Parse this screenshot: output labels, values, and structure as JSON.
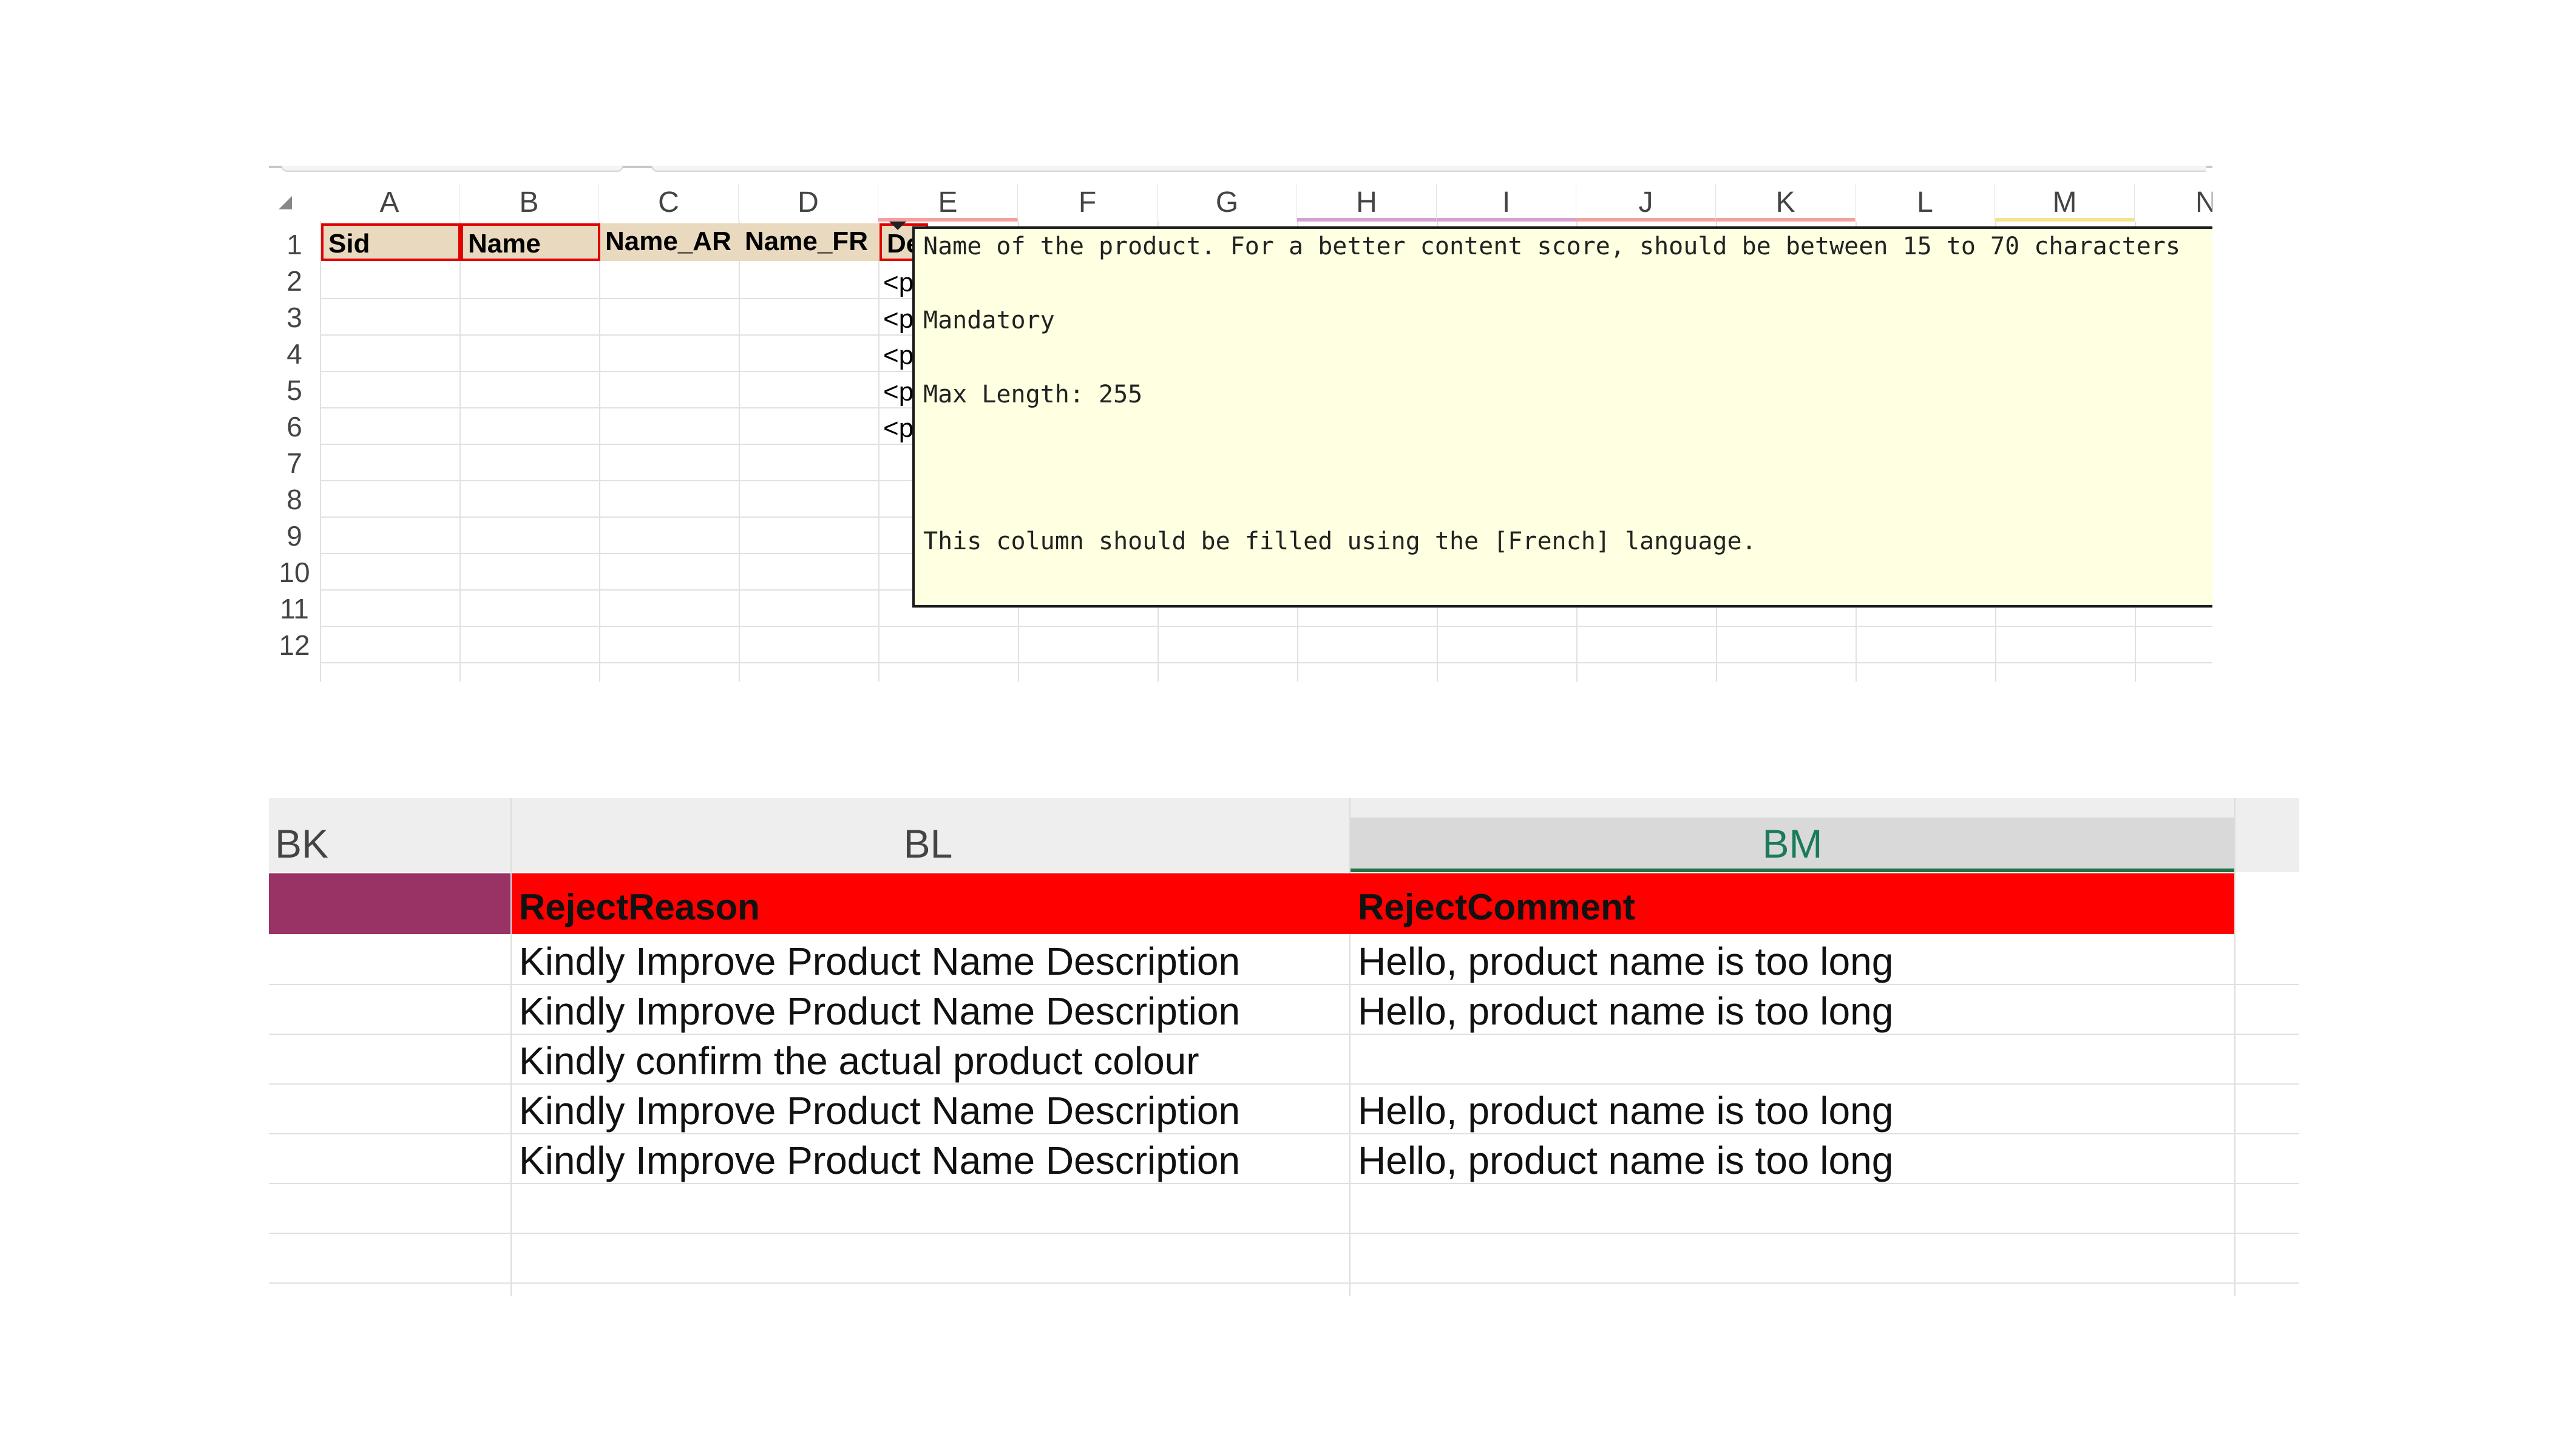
{
  "top_sheet": {
    "columns": [
      "A",
      "B",
      "C",
      "D",
      "E",
      "F",
      "G",
      "H",
      "I",
      "J",
      "K",
      "L",
      "M",
      "N"
    ],
    "rows": [
      "1",
      "2",
      "3",
      "4",
      "5",
      "6",
      "7",
      "8",
      "9",
      "10",
      "11",
      "12"
    ],
    "header_cells": {
      "A": "Sid",
      "B": "Name",
      "C": "Name_AR",
      "D": "Name_FR",
      "E": "De"
    },
    "overflow_text": "<p",
    "comment": {
      "line1": "Name of the product. For a better content score, should be between 15 to 70 characters",
      "line2": "Mandatory",
      "line3": "Max Length: 255",
      "line4": "This column should be filled using the [French] language."
    }
  },
  "bottom_sheet": {
    "columns": {
      "bk": "BK",
      "bl": "BL",
      "bm": "BM"
    },
    "headers": {
      "reject_reason": "RejectReason",
      "reject_comment": "RejectComment"
    },
    "rows": [
      {
        "reason": "Kindly Improve Product Name Description",
        "comment": "Hello, product name is too long"
      },
      {
        "reason": "Kindly Improve Product Name Description",
        "comment": "Hello, product name is too long"
      },
      {
        "reason": "Kindly confirm the actual product colour",
        "comment": ""
      },
      {
        "reason": "Kindly Improve Product Name Description",
        "comment": "Hello, product name is too long"
      },
      {
        "reason": "Kindly Improve Product Name Description",
        "comment": "Hello, product name is too long"
      }
    ],
    "colors": {
      "header_red": "#ff0000",
      "bk_purple": "#993366",
      "selected_col": "#1a7a5a"
    }
  }
}
